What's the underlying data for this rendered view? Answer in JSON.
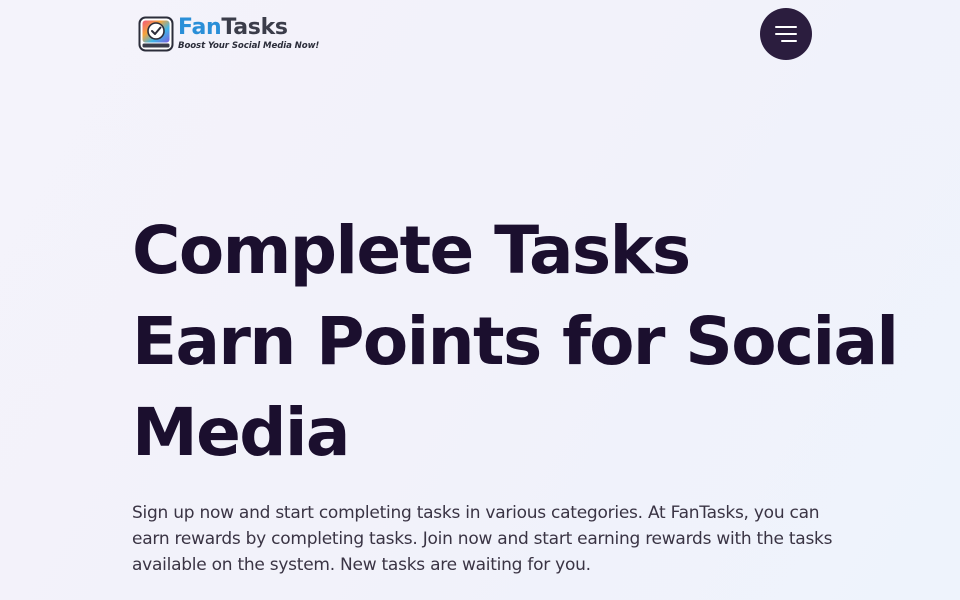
{
  "header": {
    "logo": {
      "name_part1": "Fan",
      "name_part2": "Tasks",
      "tagline": "Boost Your Social Media Now!",
      "icon": "checklist-screen-icon"
    },
    "menu_button": {
      "icon": "hamburger-menu-icon"
    }
  },
  "hero": {
    "title_lines": [
      "Complete Tasks",
      "Earn Points for Social",
      "Media"
    ],
    "description": "Sign up now and start completing tasks in various categories. At FanTasks, you can earn rewards by completing tasks. Join now and start earning rewards with the tasks available on the system. New tasks are waiting for you."
  },
  "colors": {
    "background": "#f3f3fb",
    "heading": "#1b0f2e",
    "body_text": "#3a3444",
    "menu_button": "#2b1d3e",
    "logo_blue": "#2a8fd8",
    "logo_dark": "#3b3d4a"
  }
}
